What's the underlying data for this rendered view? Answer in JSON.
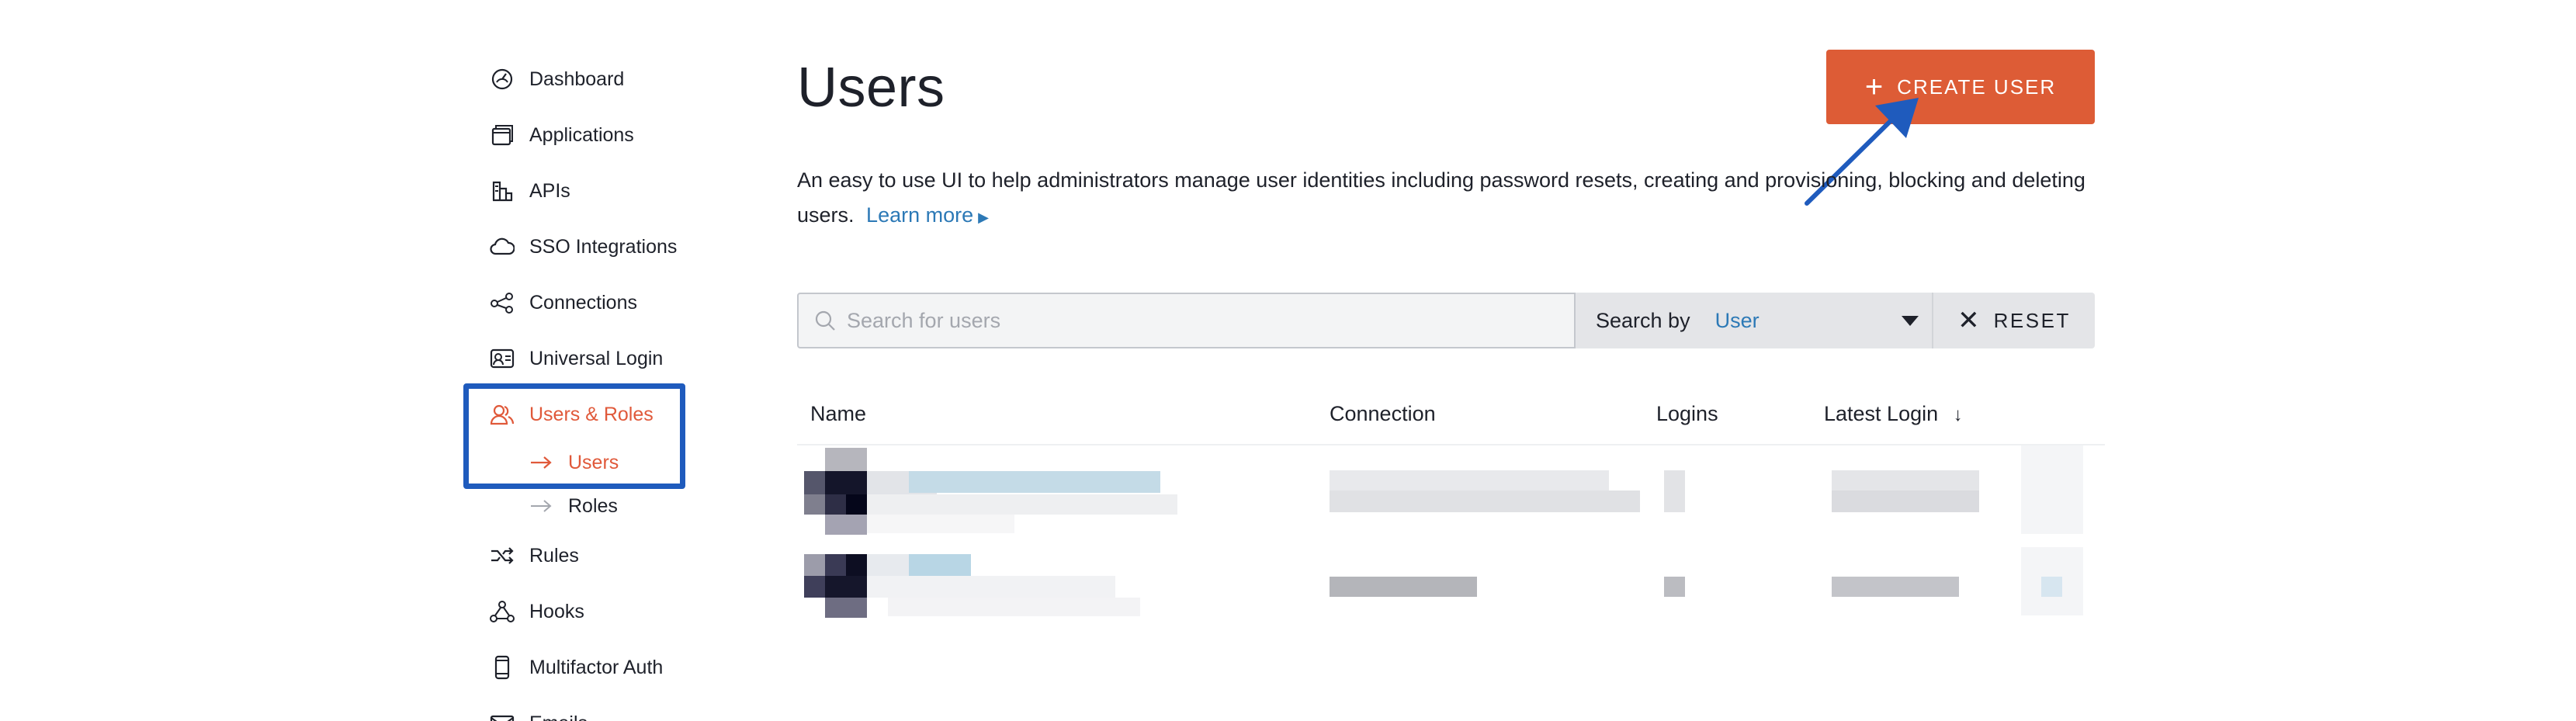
{
  "sidebar": {
    "items": [
      {
        "label": "Dashboard",
        "icon": "dashboard-icon"
      },
      {
        "label": "Applications",
        "icon": "applications-icon"
      },
      {
        "label": "APIs",
        "icon": "apis-icon"
      },
      {
        "label": "SSO Integrations",
        "icon": "cloud-icon"
      },
      {
        "label": "Connections",
        "icon": "connections-icon"
      },
      {
        "label": "Universal Login",
        "icon": "universal-login-icon"
      },
      {
        "label": "Users & Roles",
        "icon": "users-icon",
        "active": true
      },
      {
        "label": "Rules",
        "icon": "shuffle-icon"
      },
      {
        "label": "Hooks",
        "icon": "hooks-icon"
      },
      {
        "label": "Multifactor Auth",
        "icon": "phone-icon"
      },
      {
        "label": "Emails",
        "icon": "mail-icon"
      }
    ],
    "sub_items": [
      {
        "label": "Users",
        "active": true
      },
      {
        "label": "Roles"
      }
    ]
  },
  "main": {
    "title": "Users",
    "create_button": {
      "label": "CREATE USER"
    },
    "description": "An easy to use UI to help administrators manage user identities including password resets, creating and provisioning, blocking and deleting users.",
    "learn_more": "Learn more",
    "search": {
      "placeholder": "Search for users",
      "value": "",
      "search_by_label": "Search by",
      "search_by_value": "User",
      "reset_label": "RESET"
    },
    "table": {
      "columns": [
        "Name",
        "Connection",
        "Logins",
        "Latest Login"
      ],
      "sort_indicator": "↓"
    }
  },
  "colors": {
    "accent": "#dd5c36",
    "link": "#2c79b6",
    "annotation": "#1f5bbd"
  }
}
